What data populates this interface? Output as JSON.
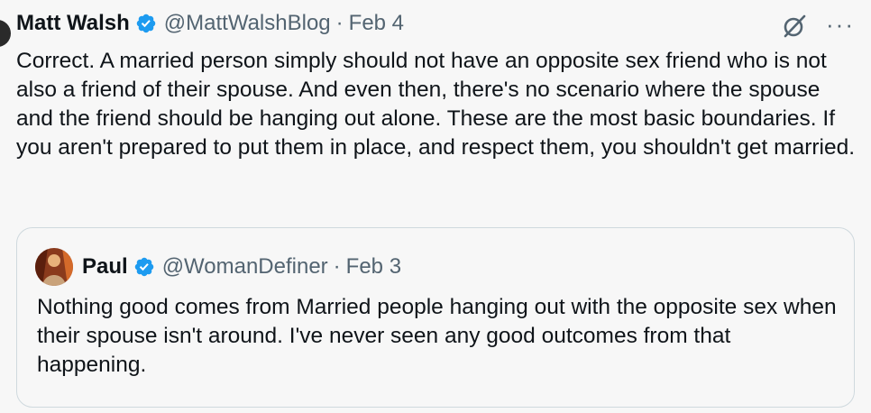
{
  "tweet": {
    "author_name": "Matt Walsh",
    "handle": "@MattWalshBlog",
    "separator": "·",
    "date": "Feb 4",
    "more_label": "···",
    "text": "Correct. A married person simply should not have an opposite sex friend who is not also a friend of their spouse. And even then, there's no scenario where the spouse and the friend should be hanging out alone. These are the most basic boundaries. If you aren't prepared to put them in place, and respect them, you shouldn't get married."
  },
  "quoted_tweet": {
    "author_name": "Paul",
    "handle": "@WomanDefiner",
    "separator": "·",
    "date": "Feb 3",
    "text": "Nothing good comes from Married people hanging out with the opposite sex when their spouse isn't around. I've never seen any good outcomes from that happening."
  },
  "colors": {
    "background": "#f7f7f7",
    "text": "#0f1419",
    "secondary": "#536471",
    "verified": "#1d9bf0",
    "border": "#cfd9de"
  },
  "icons": {
    "verified": "verified-badge-icon",
    "grok": "grok-icon",
    "more": "more-icon"
  }
}
